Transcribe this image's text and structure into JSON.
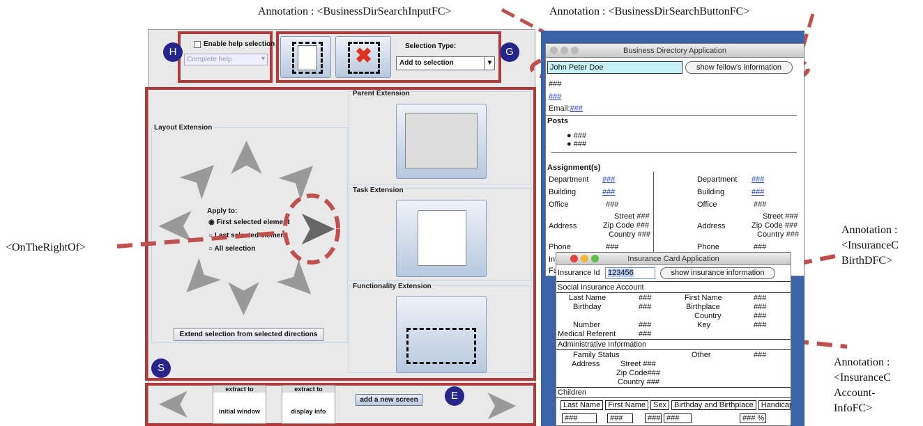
{
  "annotations": {
    "search_input": "Annotation : <BusinessDirSearchInputFC>",
    "search_button": "Annotation : <BusinessDirSearchButtonFC>",
    "on_the_right_of": "<OnTheRightOf>",
    "insurance_birth_1": "Annotation :",
    "insurance_birth_2": "<InsuranceC",
    "insurance_birth_3": "BirthDFC>",
    "insurance_acc_1": "Annotation :",
    "insurance_acc_2": "<InsuranceC",
    "insurance_acc_3": "Account-",
    "insurance_acc_4": "InfoFC>"
  },
  "badges": {
    "h": "H",
    "g": "G",
    "s": "S",
    "e": "E"
  },
  "toolbar": {
    "enable_help": "Enable help selection",
    "help_select": "Complete help",
    "selection_type_label": "Selection Type:",
    "selection_type_value": "Add to selection"
  },
  "layout_ext": {
    "title": "Layout Extension",
    "apply_to": "Apply to:",
    "opt1": "First selected element",
    "opt2": "Last selected element",
    "opt3": "All selection",
    "extend_btn": "Extend selection from selected directions"
  },
  "side_panels": {
    "parent": "Parent Extension",
    "task": "Task Extension",
    "functionality": "Functionality Extension"
  },
  "bottom": {
    "extract1_top": "extract to",
    "extract1_bottom": "initial window",
    "extract2_top": "extract to",
    "extract2_bottom": "display info",
    "add_screen": "add a new screen"
  },
  "business": {
    "title": "Business Directory Application",
    "search_value": "John Peter Doe",
    "show_btn": "show fellow's information",
    "hash": "###",
    "email_label": "Email:",
    "posts": "Posts",
    "assignments": "Assignment(s)",
    "department": "Department",
    "building": "Building",
    "office": "Office",
    "address": "Address",
    "street": "Street",
    "zip": "Zip Code",
    "country": "Country",
    "phone": "Phone",
    "int_label": "Int",
    "fax_label": "Fa"
  },
  "insurance": {
    "title": "Insurance Card Application",
    "id_label": "Insurance Id",
    "id_value": "123456",
    "show_btn": "show insurance information",
    "social": "Social Insurance Account",
    "last_name": "Last Name",
    "first_name": "First Name",
    "birthday": "Birthday",
    "birthplace": "Birthplace",
    "country": "Country",
    "number": "Number",
    "key": "Key",
    "medical": "Medical Referent",
    "admin": "Administrative Information",
    "family": "Family Status",
    "other": "Other",
    "address": "Address",
    "street": "Street ###",
    "zip": "Zip Code###",
    "country_hash": "Country ###",
    "children": "Children",
    "col_last": "Last Name",
    "col_first": "First Name",
    "col_sex": "Sex",
    "col_birth": "Birthday and Birthplace",
    "col_handicap": "Handicap",
    "hash_pct": "### %"
  }
}
